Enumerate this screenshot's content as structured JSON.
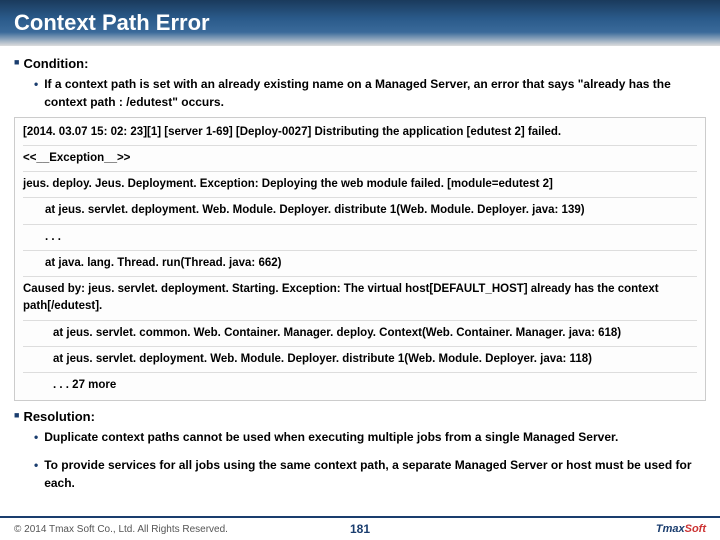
{
  "title": "Context Path Error",
  "condition": {
    "heading": "Condition:",
    "text": "If a context path is set with an already existing name on a Managed Server, an error that says \"already has the context path : /edutest\" occurs."
  },
  "log": {
    "l1": "[2014. 03.07 15: 02: 23][1] [server 1-69] [Deploy-0027] Distributing the application [edutest 2] failed.",
    "l2": "<<__Exception__>>",
    "l3": "jeus. deploy. Jeus. Deployment. Exception: Deploying the web module failed. [module=edutest 2]",
    "l4": "at jeus. servlet. deployment. Web. Module. Deployer. distribute 1(Web. Module. Deployer. java: 139)",
    "l5": ". . .",
    "l6": "at java. lang. Thread. run(Thread. java: 662)",
    "l7": "Caused by: jeus. servlet. deployment. Starting. Exception: The virtual host[DEFAULT_HOST] already has the context path[/edutest].",
    "l8": "at jeus. servlet. common. Web. Container. Manager. deploy. Context(Web. Container. Manager. java: 618)",
    "l9": "at jeus. servlet. deployment. Web. Module. Deployer. distribute 1(Web. Module. Deployer. java: 118)",
    "l10": ". . . 27 more"
  },
  "resolution": {
    "heading": "Resolution:",
    "r1": "Duplicate context paths cannot be used when executing multiple jobs from a single Managed Server.",
    "r2": "To provide services for all jobs using the same context path, a separate Managed Server or host must be used for each."
  },
  "footer": {
    "copyright": "© 2014 Tmax Soft Co., Ltd. All Rights Reserved.",
    "page": "181",
    "logo_a": "Tmax",
    "logo_b": "Soft"
  }
}
